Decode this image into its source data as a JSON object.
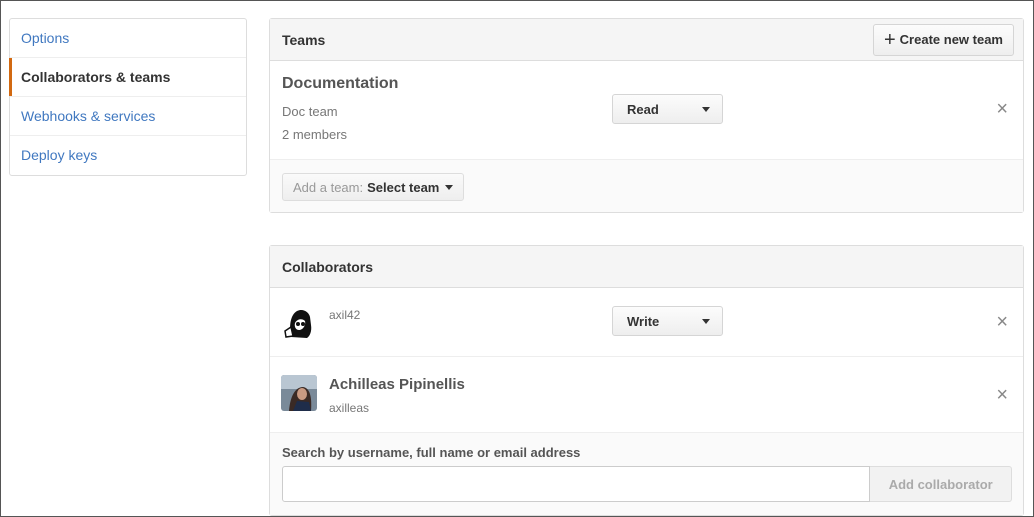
{
  "sidebar": {
    "items": [
      {
        "label": "Options",
        "selected": false
      },
      {
        "label": "Collaborators & teams",
        "selected": true
      },
      {
        "label": "Webhooks & services",
        "selected": false
      },
      {
        "label": "Deploy keys",
        "selected": false
      }
    ]
  },
  "teams": {
    "title": "Teams",
    "create_button": "Create new team",
    "create_icon": "+",
    "list": [
      {
        "name": "Documentation",
        "description": "Doc team",
        "members": "2 members",
        "permission": "Read",
        "remove_icon": "×"
      }
    ],
    "add_team_prefix": "Add a team:",
    "add_team_select": "Select team"
  },
  "collaborators": {
    "title": "Collaborators",
    "list": [
      {
        "username": "axil42",
        "full_name": "",
        "permission": "Write",
        "remove_icon": "×",
        "avatar": "avatar-bw-illustration"
      },
      {
        "username": "axilleas",
        "full_name": "Achilleas Pipinellis",
        "permission": "",
        "remove_icon": "×",
        "avatar": "avatar-photo"
      }
    ],
    "search_label": "Search by username, full name or email address",
    "search_value": "",
    "add_button": "Add collaborator"
  },
  "colors": {
    "link": "#4078c0",
    "selected_accent": "#d26911",
    "header_bg": "#f5f5f5"
  }
}
